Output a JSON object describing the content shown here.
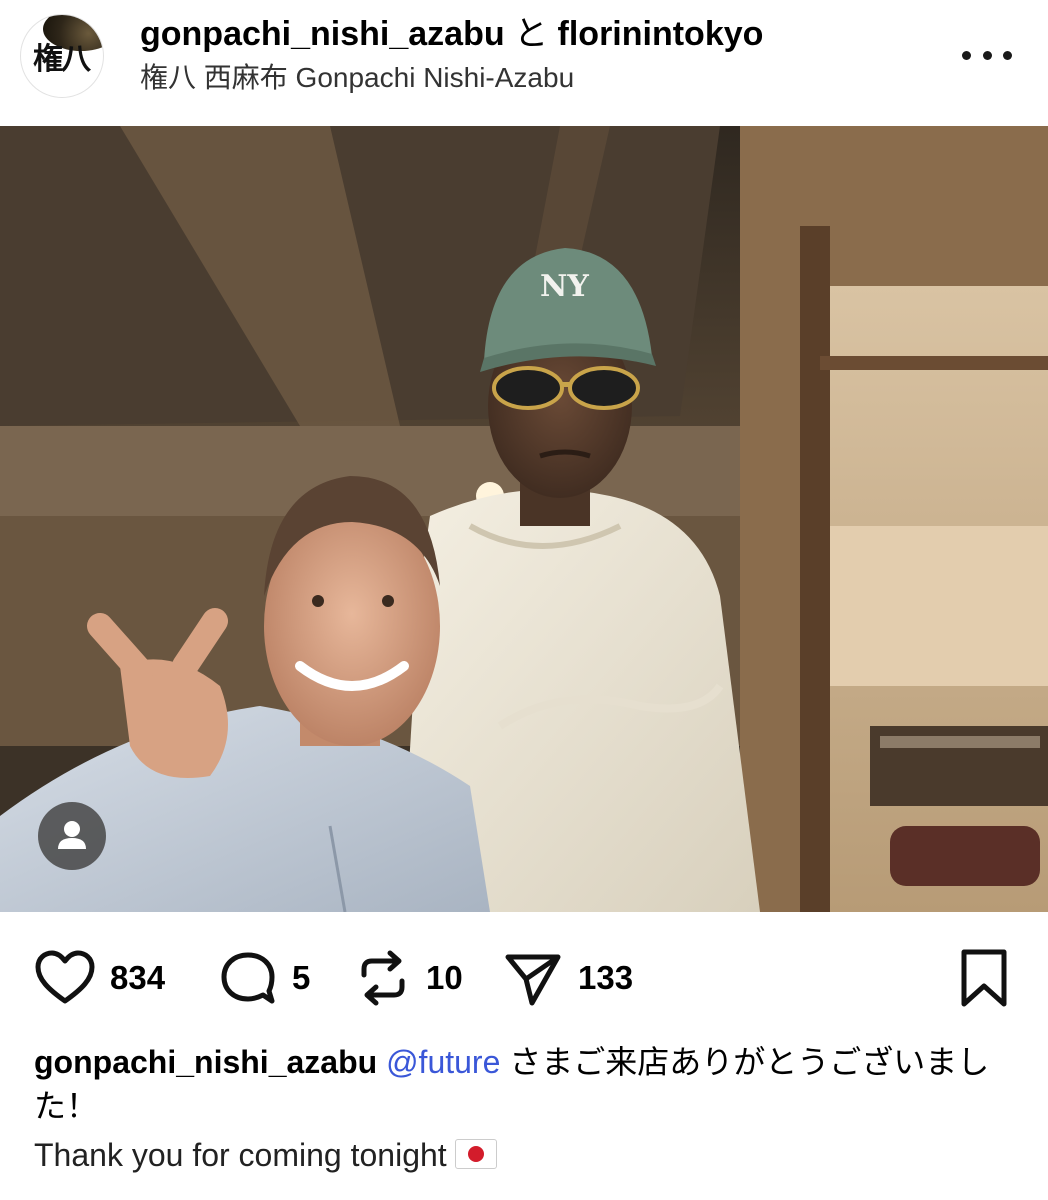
{
  "header": {
    "account": "gonpachi_nishi_azabu",
    "conjunction": "と",
    "collaborator": "florinintokyo",
    "location": "権八 西麻布 Gonpachi Nishi-Azabu",
    "avatar_text": "権八"
  },
  "actions": {
    "likes": "834",
    "comments": "5",
    "reposts": "10",
    "shares": "133"
  },
  "caption": {
    "username": "gonpachi_nishi_azabu",
    "mention": "@future",
    "text_ja": " さまご来店ありがとうございました！",
    "text_en": "Thank you for coming tonight"
  },
  "icons": {
    "more": "more-horizontal-icon",
    "like": "heart-icon",
    "comment": "comment-bubble-icon",
    "repost": "repost-icon",
    "share": "send-icon",
    "bookmark": "bookmark-icon",
    "user_tag": "user-tag-icon",
    "flag": "japan-flag-icon"
  },
  "colors": {
    "mention": "#3a57d8",
    "flag_red": "#d31c2b"
  }
}
